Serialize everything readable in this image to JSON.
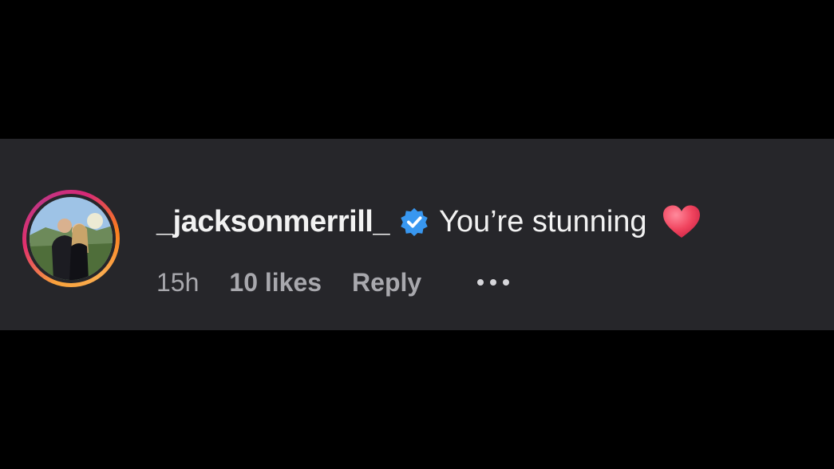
{
  "comment": {
    "username": "_jacksonmerrill_",
    "verified_icon": "verified-badge-icon",
    "text": "You’re stunning",
    "emoji_icon": "red-heart-icon",
    "time": "15h",
    "likes": "10 likes",
    "reply_label": "Reply",
    "more_icon": "more-options-icon"
  },
  "colors": {
    "page_background": "#000000",
    "card_background": "#26262a",
    "primary_text": "#f2f2f2",
    "secondary_text": "#a8a8ad",
    "verified_blue": "#3897f0",
    "heart": "#f0445e"
  }
}
